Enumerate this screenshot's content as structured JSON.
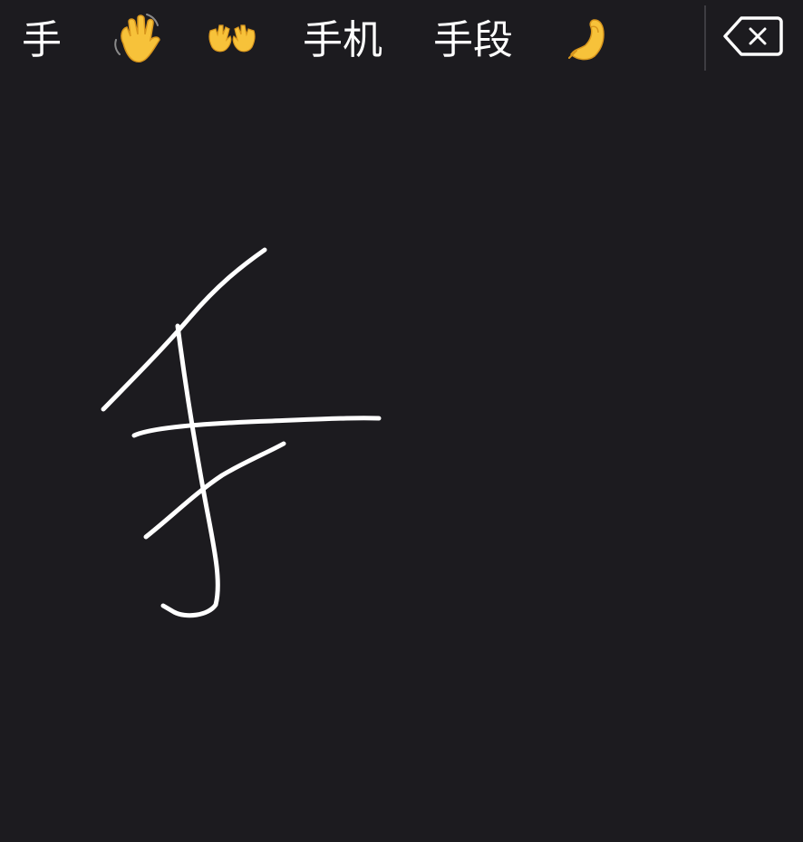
{
  "candidates": [
    {
      "label": "手",
      "kind": "text"
    },
    {
      "label": "👋",
      "kind": "emoji",
      "icon": "waving-hand-icon"
    },
    {
      "label": "👐",
      "kind": "emoji",
      "icon": "open-hands-icon"
    },
    {
      "label": "手机",
      "kind": "text"
    },
    {
      "label": "手段",
      "kind": "text"
    },
    {
      "label": "🤌",
      "kind": "emoji",
      "icon": "pinched-fingers-icon"
    }
  ],
  "delete_key": {
    "icon": "backspace-icon"
  },
  "colors": {
    "background": "#1c1b1f",
    "text": "#ffffff",
    "ink": "#ffffff",
    "emoji_skin": "#f7c23a",
    "divider": "#3d3c41"
  }
}
